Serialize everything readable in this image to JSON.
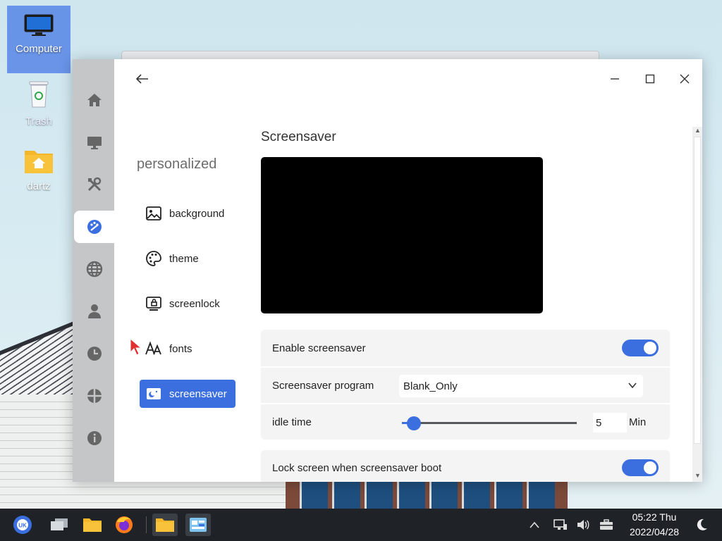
{
  "desktop": {
    "icons": [
      {
        "label": "Computer"
      },
      {
        "label": "Trash"
      },
      {
        "label": "dartz"
      }
    ]
  },
  "window": {
    "back_icon": "back-arrow-icon",
    "controls": [
      "minimize-icon",
      "maximize-icon",
      "close-icon"
    ],
    "rail": [
      {
        "icon": "home-icon"
      },
      {
        "icon": "display-icon"
      },
      {
        "icon": "tools-icon"
      },
      {
        "icon": "palette-icon",
        "active": true
      },
      {
        "icon": "globe-icon"
      },
      {
        "icon": "user-icon"
      },
      {
        "icon": "clock-icon"
      },
      {
        "icon": "network-icon"
      },
      {
        "icon": "info-icon"
      }
    ],
    "section_title": "personalized",
    "nav": [
      {
        "label": "background",
        "icon": "image-icon"
      },
      {
        "label": "theme",
        "icon": "palette-icon"
      },
      {
        "label": "screenlock",
        "icon": "lockscreen-icon"
      },
      {
        "label": "fonts",
        "icon": "font-icon"
      },
      {
        "label": "screensaver",
        "icon": "screensaver-icon",
        "active": true
      }
    ],
    "page_title": "Screensaver",
    "settings": {
      "enable_label": "Enable screensaver",
      "enable_on": true,
      "program_label": "Screensaver program",
      "program_value": "Blank_Only",
      "idle_label": "idle time",
      "idle_value": "5",
      "idle_unit": "Min",
      "idle_fraction": 0.07,
      "lock_label": "Lock screen when screensaver boot",
      "lock_on": true
    }
  },
  "taskbar": {
    "time": "05:22 Thu",
    "date": "2022/04/28"
  },
  "colors": {
    "accent": "#3b6fe0",
    "rail_bg": "#c4c6c8",
    "taskbar_bg": "#1f2328"
  }
}
